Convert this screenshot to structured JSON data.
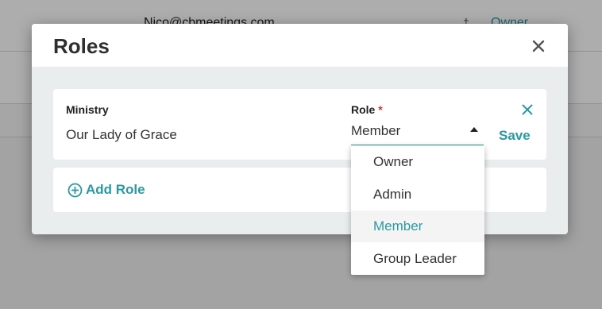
{
  "background": {
    "email": "Nico@cbmeetings.com",
    "owner_link": "Owner"
  },
  "modal": {
    "title": "Roles",
    "close_icon": "close-icon"
  },
  "role_row": {
    "ministry_label": "Ministry",
    "ministry_value": "Our Lady of Grace",
    "role_label": "Role",
    "required_mark": "*",
    "role_value": "Member",
    "save_label": "Save"
  },
  "add_role": {
    "label": "Add Role",
    "icon": "plus-circle-icon"
  },
  "dropdown": {
    "options": [
      "Owner",
      "Admin",
      "Member",
      "Group Leader"
    ],
    "highlighted": "Member"
  },
  "colors": {
    "accent": "#2a9aa2",
    "required": "#d0312d",
    "modal_bg": "#eaeded"
  }
}
